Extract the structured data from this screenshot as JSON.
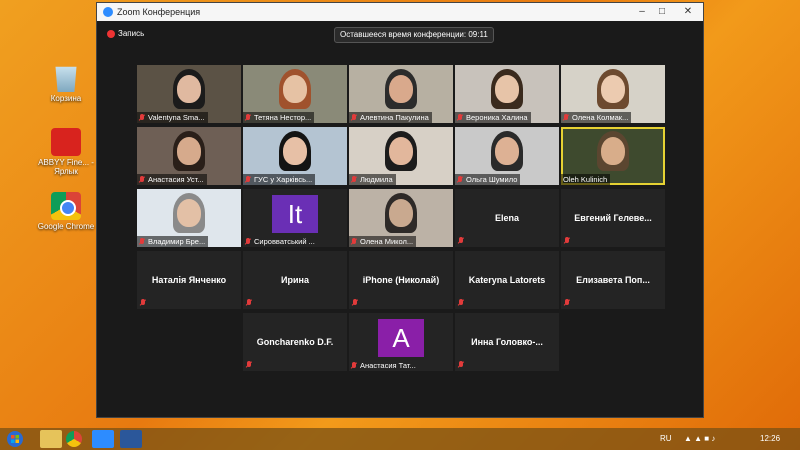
{
  "window": {
    "title": "Zoom Конференция"
  },
  "toolbar": {
    "recording_label": "Запись",
    "time_left": "Оставшееся время конференции: 09:11"
  },
  "desktop_icons": [
    {
      "label": "Корзина",
      "icon": "recycle-bin-icon"
    },
    {
      "label": "ABBYY Fine... - Ярлык",
      "icon": "abbyy-icon"
    },
    {
      "label": "Google Chrome",
      "icon": "chrome-icon"
    }
  ],
  "participants": [
    {
      "name": "Valentyna Sma...",
      "video": true,
      "muted": true
    },
    {
      "name": "Тетяна Нестор...",
      "video": true,
      "muted": true
    },
    {
      "name": "Алевтина Пакулина",
      "video": true,
      "muted": true
    },
    {
      "name": "Вероника Халина",
      "video": true,
      "muted": true
    },
    {
      "name": "Олена Колмак...",
      "video": true,
      "muted": true
    },
    {
      "name": "Анастасия Уст...",
      "video": true,
      "muted": true
    },
    {
      "name": "ГУС у Харківсь...",
      "video": true,
      "muted": true
    },
    {
      "name": "Людмила",
      "video": true,
      "muted": true
    },
    {
      "name": "Ольга Шумило",
      "video": true,
      "muted": true
    },
    {
      "name": "Oleh Kulinich",
      "video": true,
      "muted": false,
      "active": true
    },
    {
      "name": "Владимир Бре...",
      "video": true,
      "muted": true
    },
    {
      "name": "Сировватський ...",
      "video": false,
      "avatar": "It",
      "avatar_color": "#6a2fb5",
      "muted": true
    },
    {
      "name": "Олена Микол...",
      "video": true,
      "muted": true
    },
    {
      "name": "Elena",
      "video": false,
      "muted": true
    },
    {
      "name": "Евгений Гелеве...",
      "video": false,
      "muted": true
    },
    {
      "name": "Наталія Янченко",
      "video": false,
      "muted": true
    },
    {
      "name": "Ирина",
      "video": false,
      "muted": true
    },
    {
      "name": "iPhone (Николай)",
      "video": false,
      "muted": true
    },
    {
      "name": "Kateryna Latorets",
      "video": false,
      "muted": true
    },
    {
      "name": "Елизавета Поп...",
      "video": false,
      "muted": true
    },
    {
      "name": "Goncharenko D.F.",
      "video": false,
      "muted": true
    },
    {
      "name": "Анастасия Тат...",
      "video": false,
      "avatar": "A",
      "avatar_color": "#8a1fa8",
      "muted": true
    },
    {
      "name": "Инна Головко-...",
      "video": false,
      "muted": true
    }
  ],
  "taskbar": {
    "language": "RU",
    "time": "12:26"
  }
}
